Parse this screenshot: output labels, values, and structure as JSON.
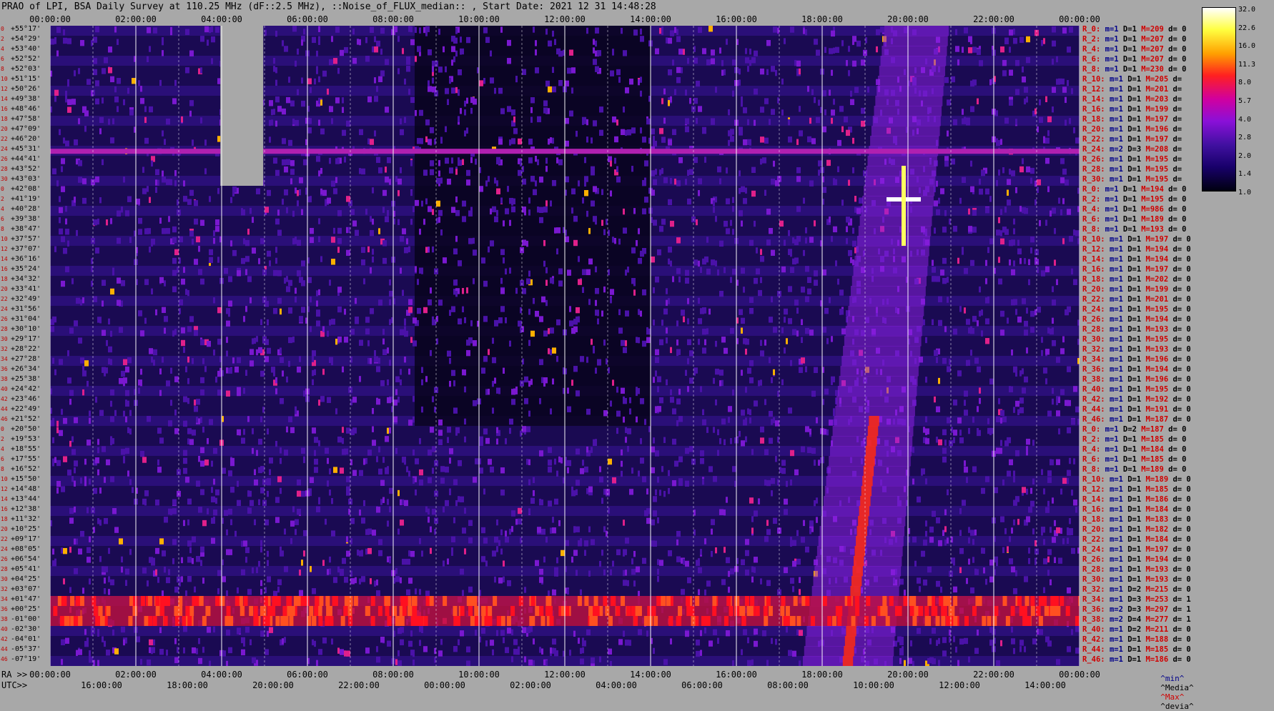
{
  "title": "PRAO of LPI, BSA Daily Survey at 110.25 MHz (dF::2.5 MHz), ::Noise_of_FLUX_median:: , Start Date: 2021 12 31 14:48:28",
  "chart_data": {
    "type": "heatmap",
    "title": "PRAO of LPI, BSA Daily Survey at 110.25 MHz (dF::2.5 MHz), ::Noise_of_FLUX_median:: , Start Date: 2021 12 31 14:48:28",
    "x_axis": {
      "label_ra": "RA >>",
      "label_utc": "UTC>>",
      "ra_range_h": [
        0,
        24
      ],
      "top_ticks": [
        "00:00:00",
        "02:00:00",
        "04:00:00",
        "06:00:00",
        "08:00:00",
        "10:00:00",
        "12:00:00",
        "14:00:00",
        "16:00:00",
        "18:00:00",
        "20:00:00",
        "22:00:00",
        "00:00:00"
      ],
      "bottom_ra_ticks": [
        "00:00:00",
        "02:00:00",
        "04:00:00",
        "06:00:00",
        "08:00:00",
        "10:00:00",
        "12:00:00",
        "14:00:00",
        "16:00:00",
        "18:00:00",
        "20:00:00",
        "22:00:00",
        "00:00:00"
      ],
      "utc_ticks": [
        {
          "ra_h": 1.2,
          "label": "16:00:00"
        },
        {
          "ra_h": 3.2,
          "label": "18:00:00"
        },
        {
          "ra_h": 5.2,
          "label": "20:00:00"
        },
        {
          "ra_h": 7.2,
          "label": "22:00:00"
        },
        {
          "ra_h": 9.2,
          "label": "00:00:00"
        },
        {
          "ra_h": 11.2,
          "label": "02:00:00"
        },
        {
          "ra_h": 13.2,
          "label": "04:00:00"
        },
        {
          "ra_h": 15.2,
          "label": "06:00:00"
        },
        {
          "ra_h": 17.2,
          "label": "08:00:00"
        },
        {
          "ra_h": 19.2,
          "label": "10:00:00"
        },
        {
          "ra_h": 21.2,
          "label": "12:00:00"
        },
        {
          "ra_h": 23.2,
          "label": "14:00:00"
        }
      ]
    },
    "y_axis": {
      "dec_labels": [
        "+55°17'",
        "+54°29'",
        "+53°40'",
        "+52°52'",
        "+52°03'",
        "+51°15'",
        "+50°26'",
        "+49°38'",
        "+48°46'",
        "+47°58'",
        "+47°09'",
        "+46°20'",
        "+45°31'",
        "+44°41'",
        "+43°52'",
        "+43°03'",
        "+42°08'",
        "+41°19'",
        "+40°28'",
        "+39°38'",
        "+38°47'",
        "+37°57'",
        "+37°07'",
        "+36°16'",
        "+35°24'",
        "+34°32'",
        "+33°41'",
        "+32°49'",
        "+31°56'",
        "+31°04'",
        "+30°10'",
        "+29°17'",
        "+28°22'",
        "+27°28'",
        "+26°34'",
        "+25°38'",
        "+24°42'",
        "+23°46'",
        "+22°49'",
        "+21°52'",
        "+20°50'",
        "+19°53'",
        "+18°55'",
        "+17°55'",
        "+16°52'",
        "+15°50'",
        "+14°48'",
        "+13°44'",
        "+12°38'",
        "+11°32'",
        "+10°25'",
        "+09°17'",
        "+08°05'",
        "+06°54'",
        "+05°41'",
        "+04°25'",
        "+03°07'",
        "+01°47'",
        "+00°25'",
        "-01°00'",
        "-02°30'",
        "-04°01'",
        "-05°37'",
        "-07°19'"
      ],
      "ray_numbers": [
        "0",
        "2",
        "4",
        "6",
        "8",
        "10",
        "12",
        "14",
        "16",
        "18",
        "20",
        "22",
        "24",
        "26",
        "28",
        "30",
        "0",
        "2",
        "4",
        "6",
        "8",
        "10",
        "12",
        "14",
        "16",
        "18",
        "20",
        "22",
        "24",
        "26",
        "28",
        "30",
        "32",
        "34",
        "36",
        "38",
        "40",
        "42",
        "44",
        "46",
        "0",
        "2",
        "4",
        "6",
        "8",
        "10",
        "12",
        "14",
        "16",
        "18",
        "20",
        "22",
        "24",
        "26",
        "28",
        "30",
        "32",
        "34",
        "36",
        "38",
        "40",
        "42",
        "44",
        "46"
      ]
    },
    "colorbar": {
      "labels": [
        "32.0",
        "22.6",
        "16.0",
        "11.3",
        "8.0",
        "5.7",
        "4.0",
        "2.8",
        "2.0",
        "1.4",
        "1.0"
      ],
      "range": [
        1.0,
        32.0
      ],
      "scale": "log"
    },
    "features": {
      "gap_ra_h": [
        3.97,
        4.97
      ],
      "gap_row_range": [
        0,
        16
      ],
      "band_row": 12,
      "bright_source": {
        "ra_h": 19.9,
        "row": 17
      },
      "emission_track": "diagonal from RA ~18.5h at bottom rows to RA ~20.2h at top rows",
      "bright_band_rows": [
        57,
        58,
        59
      ]
    },
    "colors": {
      "low": "#000010",
      "mid": "#8a10d8",
      "high": "#ff2020",
      "max": "#ffffff",
      "background": "#a8a8a8",
      "stat_red": "#d00000",
      "stat_blue": "#00008a"
    }
  },
  "stats": [
    {
      "r": "R_0:",
      "m": "m=1",
      "D": "D=1",
      "M": "M=209",
      "d": "d= 0"
    },
    {
      "r": "R_2:",
      "m": "m=1",
      "D": "D=1",
      "M": "M=207",
      "d": "d= 0"
    },
    {
      "r": "R_4:",
      "m": "m=1",
      "D": "D=1",
      "M": "M=207",
      "d": "d= 0"
    },
    {
      "r": "R_6:",
      "m": "m=1",
      "D": "D=1",
      "M": "M=207",
      "d": "d= 0"
    },
    {
      "r": "R_8:",
      "m": "m=1",
      "D": "D=1",
      "M": "M=230",
      "d": "d= 0"
    },
    {
      "r": "R_10:",
      "m": "m=1",
      "D": "D=1",
      "M": "M=205",
      "d": "d="
    },
    {
      "r": "R_12:",
      "m": "m=1",
      "D": "D=1",
      "M": "M=201",
      "d": "d="
    },
    {
      "r": "R_14:",
      "m": "m=1",
      "D": "D=1",
      "M": "M=203",
      "d": "d="
    },
    {
      "r": "R_16:",
      "m": "m=1",
      "D": "D=1",
      "M": "M=199",
      "d": "d="
    },
    {
      "r": "R_18:",
      "m": "m=1",
      "D": "D=1",
      "M": "M=197",
      "d": "d="
    },
    {
      "r": "R_20:",
      "m": "m=1",
      "D": "D=1",
      "M": "M=196",
      "d": "d="
    },
    {
      "r": "R_22:",
      "m": "m=1",
      "D": "D=1",
      "M": "M=197",
      "d": "d="
    },
    {
      "r": "R_24:",
      "m": "m=2",
      "D": "D=3",
      "M": "M=208",
      "d": "d="
    },
    {
      "r": "R_26:",
      "m": "m=1",
      "D": "D=1",
      "M": "M=195",
      "d": "d="
    },
    {
      "r": "R_28:",
      "m": "m=1",
      "D": "D=1",
      "M": "M=195",
      "d": "d="
    },
    {
      "r": "R_30:",
      "m": "m=1",
      "D": "D=1",
      "M": "M=195",
      "d": "d="
    },
    {
      "r": "R_0:",
      "m": "m=1",
      "D": "D=1",
      "M": "M=194",
      "d": "d= 0"
    },
    {
      "r": "R_2:",
      "m": "m=1",
      "D": "D=1",
      "M": "M=195",
      "d": "d= 0"
    },
    {
      "r": "R_4:",
      "m": "m=1",
      "D": "D=1",
      "M": "M=986",
      "d": "d= 0"
    },
    {
      "r": "R_6:",
      "m": "m=1",
      "D": "D=1",
      "M": "M=189",
      "d": "d= 0"
    },
    {
      "r": "R_8:",
      "m": "m=1",
      "D": "D=1",
      "M": "M=193",
      "d": "d= 0"
    },
    {
      "r": "R_10:",
      "m": "m=1",
      "D": "D=1",
      "M": "M=197",
      "d": "d= 0"
    },
    {
      "r": "R_12:",
      "m": "m=1",
      "D": "D=1",
      "M": "M=194",
      "d": "d= 0"
    },
    {
      "r": "R_14:",
      "m": "m=1",
      "D": "D=1",
      "M": "M=194",
      "d": "d= 0"
    },
    {
      "r": "R_16:",
      "m": "m=1",
      "D": "D=1",
      "M": "M=197",
      "d": "d= 0"
    },
    {
      "r": "R_18:",
      "m": "m=1",
      "D": "D=1",
      "M": "M=202",
      "d": "d= 0"
    },
    {
      "r": "R_20:",
      "m": "m=1",
      "D": "D=1",
      "M": "M=199",
      "d": "d= 0"
    },
    {
      "r": "R_22:",
      "m": "m=1",
      "D": "D=1",
      "M": "M=201",
      "d": "d= 0"
    },
    {
      "r": "R_24:",
      "m": "m=1",
      "D": "D=1",
      "M": "M=195",
      "d": "d= 0"
    },
    {
      "r": "R_26:",
      "m": "m=1",
      "D": "D=1",
      "M": "M=194",
      "d": "d= 0"
    },
    {
      "r": "R_28:",
      "m": "m=1",
      "D": "D=1",
      "M": "M=193",
      "d": "d= 0"
    },
    {
      "r": "R_30:",
      "m": "m=1",
      "D": "D=1",
      "M": "M=195",
      "d": "d= 0"
    },
    {
      "r": "R_32:",
      "m": "m=1",
      "D": "D=1",
      "M": "M=193",
      "d": "d= 0"
    },
    {
      "r": "R_34:",
      "m": "m=1",
      "D": "D=1",
      "M": "M=196",
      "d": "d= 0"
    },
    {
      "r": "R_36:",
      "m": "m=1",
      "D": "D=1",
      "M": "M=194",
      "d": "d= 0"
    },
    {
      "r": "R_38:",
      "m": "m=1",
      "D": "D=1",
      "M": "M=196",
      "d": "d= 0"
    },
    {
      "r": "R_40:",
      "m": "m=1",
      "D": "D=1",
      "M": "M=195",
      "d": "d= 0"
    },
    {
      "r": "R_42:",
      "m": "m=1",
      "D": "D=1",
      "M": "M=192",
      "d": "d= 0"
    },
    {
      "r": "R_44:",
      "m": "m=1",
      "D": "D=1",
      "M": "M=191",
      "d": "d= 0"
    },
    {
      "r": "R_46:",
      "m": "m=1",
      "D": "D=1",
      "M": "M=187",
      "d": "d= 0"
    },
    {
      "r": "R_0:",
      "m": "m=1",
      "D": "D=2",
      "M": "M=187",
      "d": "d= 0"
    },
    {
      "r": "R_2:",
      "m": "m=1",
      "D": "D=1",
      "M": "M=185",
      "d": "d= 0"
    },
    {
      "r": "R_4:",
      "m": "m=1",
      "D": "D=1",
      "M": "M=184",
      "d": "d= 0"
    },
    {
      "r": "R_6:",
      "m": "m=1",
      "D": "D=1",
      "M": "M=185",
      "d": "d= 0"
    },
    {
      "r": "R_8:",
      "m": "m=1",
      "D": "D=1",
      "M": "M=189",
      "d": "d= 0"
    },
    {
      "r": "R_10:",
      "m": "m=1",
      "D": "D=1",
      "M": "M=189",
      "d": "d= 0"
    },
    {
      "r": "R_12:",
      "m": "m=1",
      "D": "D=1",
      "M": "M=185",
      "d": "d= 0"
    },
    {
      "r": "R_14:",
      "m": "m=1",
      "D": "D=1",
      "M": "M=186",
      "d": "d= 0"
    },
    {
      "r": "R_16:",
      "m": "m=1",
      "D": "D=1",
      "M": "M=184",
      "d": "d= 0"
    },
    {
      "r": "R_18:",
      "m": "m=1",
      "D": "D=1",
      "M": "M=183",
      "d": "d= 0"
    },
    {
      "r": "R_20:",
      "m": "m=1",
      "D": "D=1",
      "M": "M=182",
      "d": "d= 0"
    },
    {
      "r": "R_22:",
      "m": "m=1",
      "D": "D=1",
      "M": "M=184",
      "d": "d= 0"
    },
    {
      "r": "R_24:",
      "m": "m=1",
      "D": "D=1",
      "M": "M=197",
      "d": "d= 0"
    },
    {
      "r": "R_26:",
      "m": "m=1",
      "D": "D=1",
      "M": "M=194",
      "d": "d= 0"
    },
    {
      "r": "R_28:",
      "m": "m=1",
      "D": "D=1",
      "M": "M=193",
      "d": "d= 0"
    },
    {
      "r": "R_30:",
      "m": "m=1",
      "D": "D=1",
      "M": "M=193",
      "d": "d= 0"
    },
    {
      "r": "R_32:",
      "m": "m=1",
      "D": "D=2",
      "M": "M=215",
      "d": "d= 0"
    },
    {
      "r": "R_34:",
      "m": "m=1",
      "D": "D=3",
      "M": "M=253",
      "d": "d= 1"
    },
    {
      "r": "R_36:",
      "m": "m=2",
      "D": "D=3",
      "M": "M=297",
      "d": "d= 1"
    },
    {
      "r": "R_38:",
      "m": "m=2",
      "D": "D=4",
      "M": "M=277",
      "d": "d= 1"
    },
    {
      "r": "R_40:",
      "m": "m=1",
      "D": "D=2",
      "M": "M=211",
      "d": "d= 0"
    },
    {
      "r": "R_42:",
      "m": "m=1",
      "D": "D=1",
      "M": "M=188",
      "d": "d= 0"
    },
    {
      "r": "R_44:",
      "m": "m=1",
      "D": "D=1",
      "M": "M=185",
      "d": "d= 0"
    },
    {
      "r": "R_46:",
      "m": "m=1",
      "D": "D=1",
      "M": "M=186",
      "d": "d= 0"
    }
  ],
  "legend_keys": {
    "min": "^min^",
    "median": "^Media^",
    "max": "^Max^",
    "dev": "^devia^"
  }
}
